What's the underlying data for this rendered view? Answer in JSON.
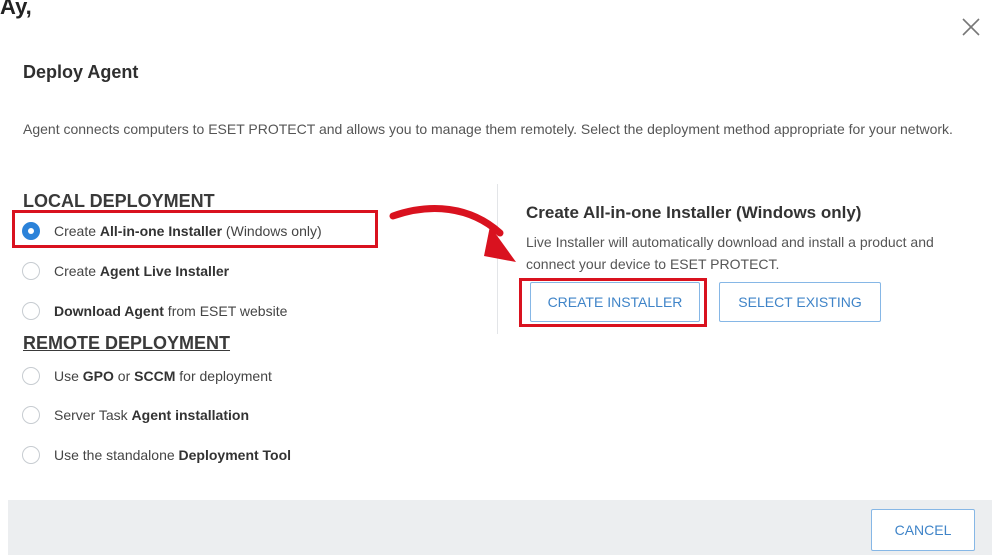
{
  "background_text": "Ay,",
  "dialog": {
    "title": "Deploy Agent",
    "description": "Agent connects computers to ESET PROTECT and allows you to manage them remotely. Select the deployment method appropriate for your network.",
    "close_icon": "close-icon"
  },
  "local": {
    "heading": "LOCAL DEPLOYMENT",
    "options": [
      {
        "pre": "Create ",
        "bold": "All-in-one Installer",
        "post": " (Windows only)",
        "selected": true
      },
      {
        "pre": "Create ",
        "bold": "Agent Live Installer",
        "post": "",
        "selected": false
      },
      {
        "pre": "",
        "bold": "Download Agent",
        "post": " from ESET website",
        "selected": false
      }
    ]
  },
  "remote": {
    "heading": "REMOTE DEPLOYMENT",
    "options": [
      {
        "pre": "Use ",
        "bold": "GPO",
        "mid": " or ",
        "bold2": "SCCM",
        "post": " for deployment",
        "selected": false
      },
      {
        "pre": "Server Task ",
        "bold": "Agent installation",
        "post": "",
        "selected": false
      },
      {
        "pre": "Use the standalone ",
        "bold": "Deployment Tool",
        "post": "",
        "selected": false
      }
    ]
  },
  "detail": {
    "title": "Create All-in-one Installer (Windows only)",
    "description": "Live Installer will automatically download and install a product and connect your device to ESET PROTECT.",
    "create_button": "CREATE INSTALLER",
    "select_button": "SELECT EXISTING"
  },
  "footer": {
    "cancel_button": "CANCEL"
  },
  "colors": {
    "accent": "#2b82d9",
    "highlight": "#d9121f",
    "button_text": "#3f84c8",
    "footer_bg": "#eceef0"
  }
}
